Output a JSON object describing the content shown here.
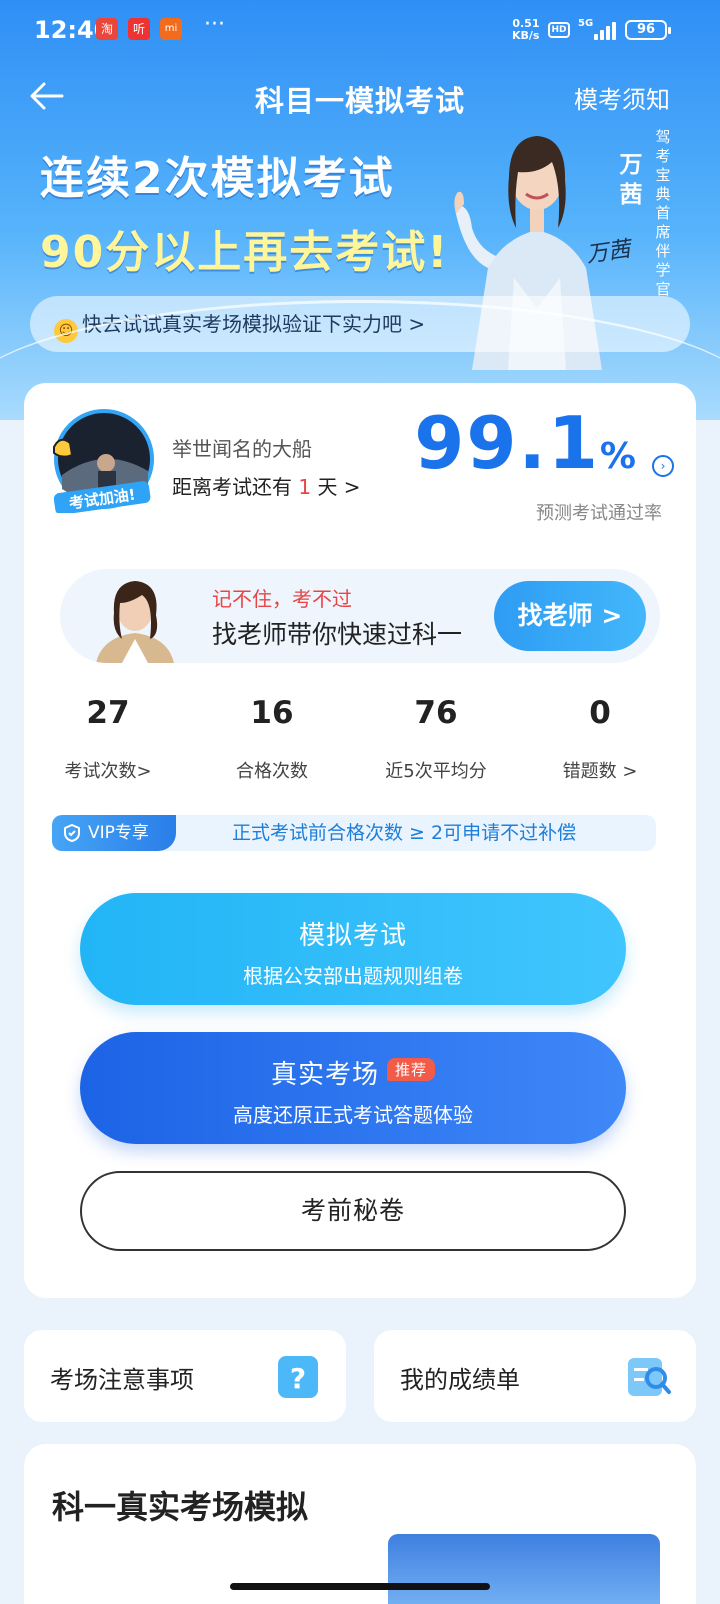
{
  "status_bar": {
    "time": "12:40",
    "app_icons": [
      "淘",
      "听",
      "mi"
    ],
    "more": "···",
    "net_speed_value": "0.51",
    "net_speed_unit": "KB/s",
    "hd": "HD",
    "network": "5G",
    "battery": "96"
  },
  "header": {
    "title": "科目一模拟考试",
    "right_link": "模考须知"
  },
  "banner": {
    "line1": "连续2次模拟考试",
    "line2": "90分以上再去考试!",
    "spokesperson_name": "万茜",
    "spokesperson_title": "驾考宝典首席伴学官",
    "signature": "万茜",
    "promo": "快去试试真实考场模拟验证下实力吧 >"
  },
  "profile": {
    "avatar_badge": "考试加油!",
    "username": "举世闻名的大船",
    "countdown_prefix": "距离考试还有 ",
    "countdown_days": "1",
    "countdown_suffix": " 天 >",
    "pass_rate": "99.1",
    "pass_rate_unit": "%",
    "pass_rate_label": "预测考试通过率"
  },
  "teacher": {
    "line1": "记不住，考不过",
    "line2": "找老师带你快速过科一",
    "button": "找老师 >"
  },
  "stats": [
    {
      "value": "27",
      "label": "考试次数>"
    },
    {
      "value": "16",
      "label": "合格次数"
    },
    {
      "value": "76",
      "label": "近5次平均分"
    },
    {
      "value": "0",
      "label": "错题数 >"
    }
  ],
  "vip": {
    "tag": "VIP专享",
    "text": "正式考试前合格次数 ≥ 2可申请不过补偿"
  },
  "buttons": {
    "mock_title": "模拟考试",
    "mock_sub": "根据公安部出题规则组卷",
    "real_title": "真实考场",
    "real_badge": "推荐",
    "real_sub": "高度还原正式考试答题体验",
    "secret": "考前秘卷"
  },
  "tiles": {
    "notice": "考场注意事项",
    "report": "我的成绩单"
  },
  "section": {
    "title": "科一真实考场模拟"
  },
  "colors": {
    "primary": "#1b73ec",
    "accent_red": "#e84545",
    "light_button": "#22b5f6",
    "dark_button": "#1c63e6"
  }
}
